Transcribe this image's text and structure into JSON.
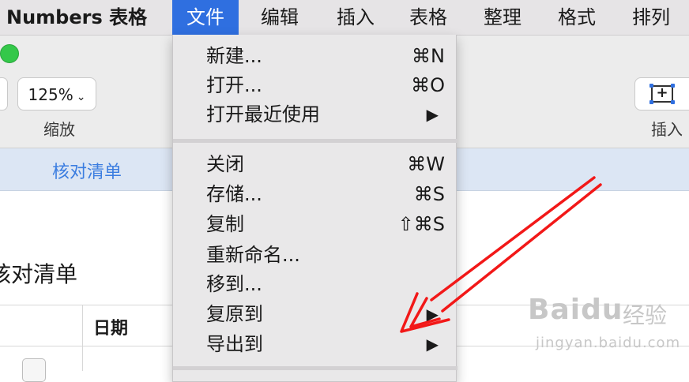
{
  "menubar": {
    "app": "Numbers 表格",
    "items": [
      "文件",
      "编辑",
      "插入",
      "表格",
      "整理",
      "格式",
      "排列"
    ]
  },
  "toolbar": {
    "zoom_value": "125%",
    "zoom_label": "缩放",
    "insert_label": "插入"
  },
  "tabs": {
    "active": "核对清单"
  },
  "sheet": {
    "title": "核对清单",
    "column_date": "日期"
  },
  "file_menu": {
    "group1": [
      {
        "label": "新建...",
        "shortcut": "⌘N"
      },
      {
        "label": "打开...",
        "shortcut": "⌘O"
      },
      {
        "label": "打开最近使用",
        "submenu": "▶"
      }
    ],
    "group2": [
      {
        "label": "关闭",
        "shortcut": "⌘W"
      },
      {
        "label": "存储...",
        "shortcut": "⌘S"
      },
      {
        "label": "复制",
        "shortcut": "⇧⌘S"
      },
      {
        "label": "重新命名..."
      },
      {
        "label": "移到..."
      },
      {
        "label": "复原到",
        "submenu": "▶"
      },
      {
        "label": "导出到",
        "submenu": "▶"
      }
    ]
  },
  "colors": {
    "menu_highlight": "#2f6fe0",
    "tab_text": "#3b7de0",
    "annotation": "#f21818"
  },
  "icons": [
    "chevron-down-icon",
    "insert-table-icon",
    "submenu-arrow-icon",
    "annotation-arrow"
  ],
  "watermark": {
    "brand": "Baidu",
    "brand_cn": "经验",
    "url": "jingyan.baidu.com"
  }
}
